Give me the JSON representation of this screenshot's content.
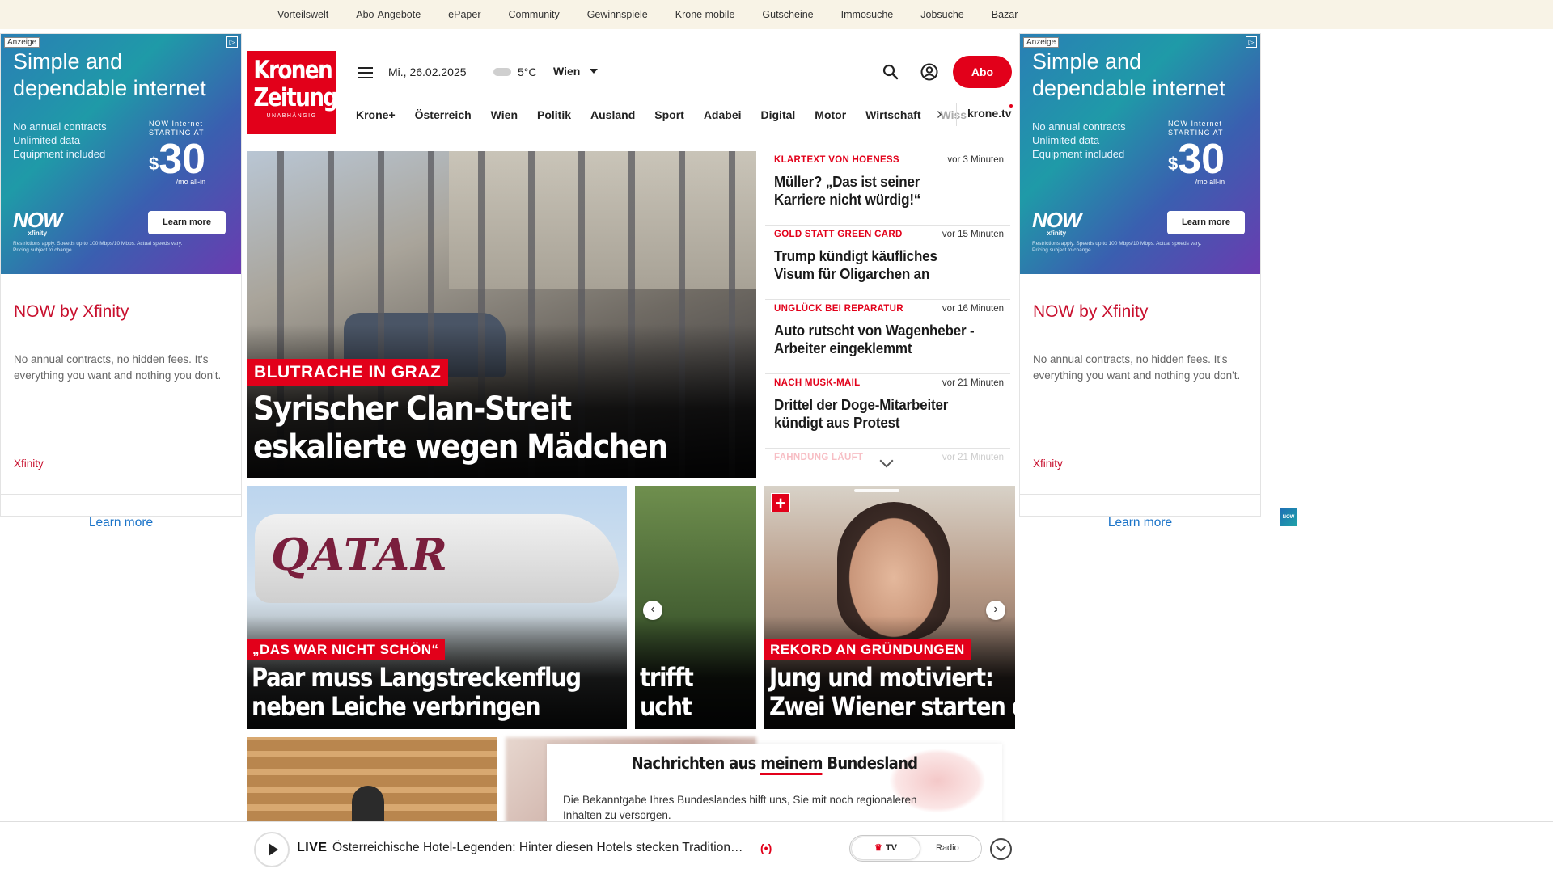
{
  "topnav": [
    "Vorteilswelt",
    "Abo-Angebote",
    "ePaper",
    "Community",
    "Gewinnspiele",
    "Krone mobile",
    "Gutscheine",
    "Immosuche",
    "Jobsuche",
    "Bazar"
  ],
  "ad": {
    "tag": "Anzeige",
    "headline": "Simple and dependable internet",
    "bullets": "No annual contracts\nUnlimited data\nEquipment included",
    "price_label": "NOW Internet\nSTARTING AT",
    "price_currency": "$",
    "price_value": "30",
    "price_unit": "/mo all-in",
    "brand_logo": "NOW",
    "brand_logo_sub": "xfinity",
    "button": "Learn more",
    "fine_print": "Restrictions apply. Speeds up to 100 Mbps/10 Mbps. Actual speeds vary. Pricing subject to change.",
    "brand_name": "NOW by Xfinity",
    "description": "No annual contracts, no hidden fees. It's everything you want and nothing you don't.",
    "source": "Xfinity",
    "source_logo": "NOW",
    "learn_more": "Learn more"
  },
  "header": {
    "logo_line1": "Kronen",
    "logo_line2": "Zeitung",
    "logo_tagline": "UNABHÄNGIG",
    "date": "Mi., 26.02.2025",
    "temperature": "5°C",
    "city": "Wien",
    "abo_label": "Abo"
  },
  "nav": {
    "items": [
      "Krone+",
      "Österreich",
      "Wien",
      "Politik",
      "Ausland",
      "Sport",
      "Adabei",
      "Digital",
      "Motor",
      "Wirtschaft"
    ],
    "faded_item": "Wiss",
    "tv_label": "krone.tv"
  },
  "hero": {
    "kicker": "BLUTRACHE IN GRAZ",
    "title": "Syrischer Clan-Streit eskalierte wegen Mädchen"
  },
  "ticker": [
    {
      "kicker": "KLARTEXT VON HOENESS",
      "time": "vor 3 Minuten",
      "title": "Müller? „Das ist seiner Karriere nicht würdig!“"
    },
    {
      "kicker": "GOLD STATT GREEN CARD",
      "time": "vor 15 Minuten",
      "title": "Trump kündigt käufliches Visum für Oligarchen an"
    },
    {
      "kicker": "UNGLÜCK BEI REPARATUR",
      "time": "vor 16 Minuten",
      "title": "Auto rutscht von Wagenheber - Arbeiter eingeklemmt"
    },
    {
      "kicker": "NACH MUSK-MAIL",
      "time": "vor 21 Minuten",
      "title": "Drittel der Doge-Mitarbeiter kündigt aus Protest"
    },
    {
      "kicker": "FAHNDUNG LÄUFT",
      "time": "vor 21 Minuten",
      "title": ""
    }
  ],
  "cards": [
    {
      "image_text": "QATAR",
      "kicker": "„DAS WAR NICHT SCHÖN“",
      "title_line1": "Paar muss Langstreckenflug",
      "title_line2": "neben Leiche verbringen"
    },
    {
      "kicker": "",
      "title_line1": "trifft",
      "title_line2": "ucht"
    },
    {
      "kicker": "REKORD AN GRÜNDUNGEN",
      "title_line1": "Jung und motiviert:",
      "title_line2": "Zwei Wiener starten d"
    }
  ],
  "carousel": {
    "prev": "‹",
    "next": "›",
    "plus": "+"
  },
  "popup": {
    "title_pre": "Nachrichten aus ",
    "title_underlined": "meinem",
    "title_post": " Bundesland",
    "text": "Die Bekanntgabe Ihres Bundeslandes hilft uns, Sie mit noch regionaleren Inhalten zu versorgen."
  },
  "player": {
    "live_label": "LIVE",
    "now_playing": "Österreichische Hotel-Legenden: Hinter diesen Hotels stecken Tradition…",
    "radio_symbol": "(•)",
    "tv_label": "TV",
    "radio_label": "Radio"
  },
  "colors": {
    "brand_red": "#e2001a",
    "topbar_bg": "#f8f3e6",
    "ad_link": "#1a73c8"
  }
}
